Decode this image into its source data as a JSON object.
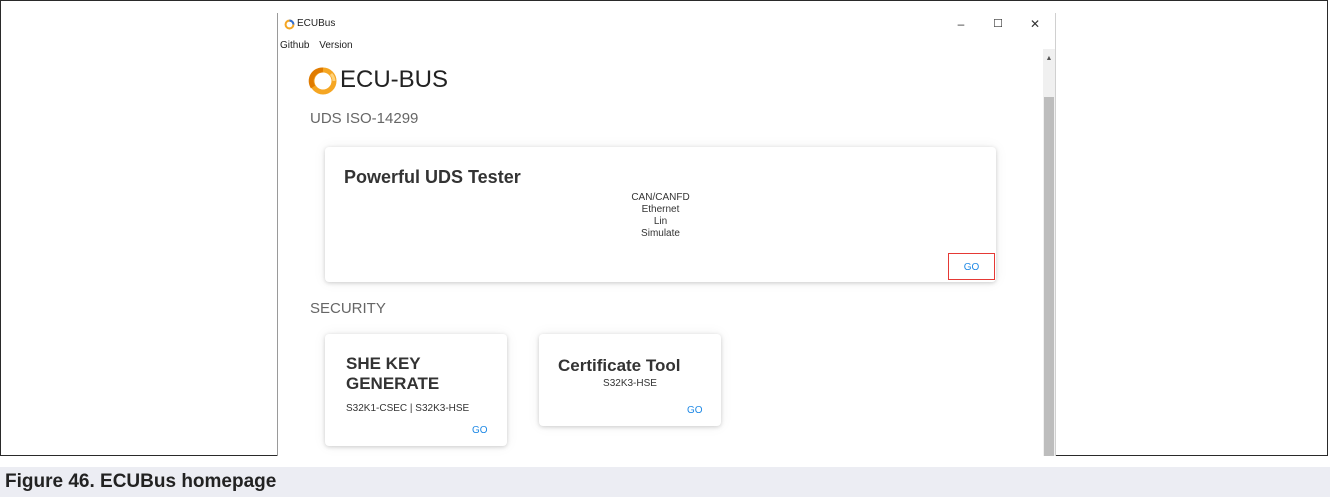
{
  "window": {
    "title": "ECUBus",
    "controls": {
      "minimize": "–",
      "maximize": "☐",
      "close": "✕"
    }
  },
  "menu": [
    "Github",
    "Version"
  ],
  "brand": {
    "name": "ECU-BUS",
    "accent": "#f5a623"
  },
  "sections": {
    "uds": "UDS ISO-14299",
    "security": "SECURITY"
  },
  "uds_card": {
    "title": "Powerful UDS Tester",
    "features": [
      "CAN/CANFD",
      "Ethernet",
      "Lin",
      "Simulate"
    ],
    "go": "GO"
  },
  "she_card": {
    "title_line1": "SHE KEY",
    "title_line2": "GENERATE",
    "subtitle": "S32K1-CSEC | S32K3-HSE",
    "go": "GO"
  },
  "cert_card": {
    "title": "Certificate Tool",
    "subtitle": "S32K3-HSE",
    "go": "GO"
  },
  "caption": "Figure 46.  ECUBus homepage",
  "colors": {
    "link": "#1e88e5",
    "highlight": "#e53935"
  }
}
